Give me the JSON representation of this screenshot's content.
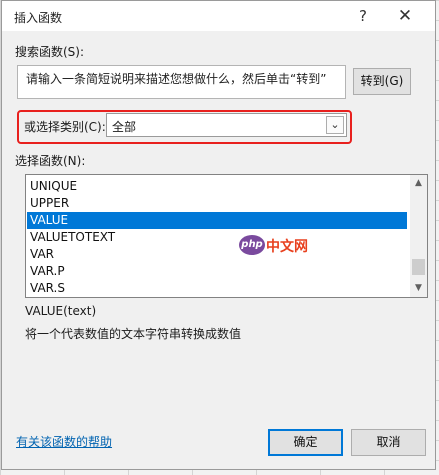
{
  "dialog": {
    "title": "插入函数",
    "help_glyph": "?",
    "close_glyph": "✕"
  },
  "search": {
    "label": "搜索函数(S):",
    "value": "请输入一条简短说明来描述您想做什么，然后单击“转到”",
    "go_label": "转到(G)"
  },
  "category": {
    "label": "或选择类别(C):",
    "selected": "全部"
  },
  "functions": {
    "label": "选择函数(N):",
    "items": [
      "UNIQUE",
      "UPPER",
      "VALUE",
      "VALUETOTEXT",
      "VAR",
      "VAR.P",
      "VAR.S"
    ],
    "selected_index": 2
  },
  "details": {
    "signature": "VALUE(text)",
    "description": "将一个代表数值的文本字符串转换成数值"
  },
  "footer": {
    "help_link": "有关该函数的帮助",
    "ok_label": "确定",
    "cancel_label": "取消"
  },
  "watermark": {
    "logo": "php",
    "text": "中文网"
  },
  "colors": {
    "selection": "#0078d7",
    "highlight_box": "#e8201e",
    "link": "#0063b1"
  }
}
